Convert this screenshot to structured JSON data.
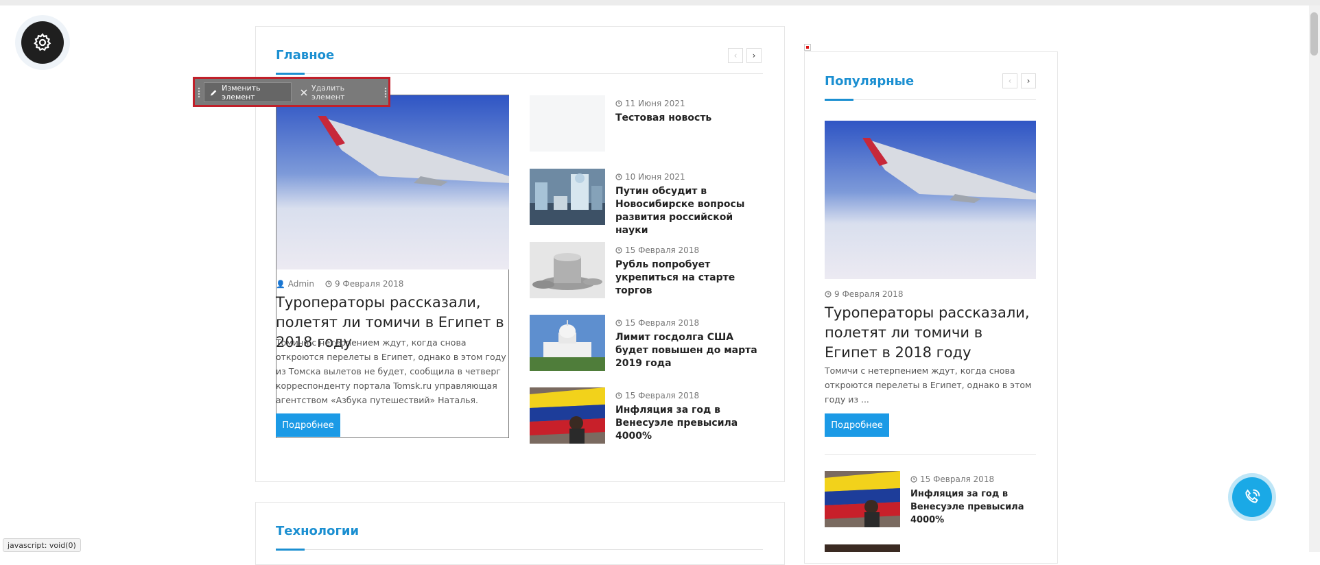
{
  "status_bar": {
    "text": "javascript: void(0)"
  },
  "edit_toolbar": {
    "edit_label": "Изменить элемент",
    "delete_label": "Удалить элемент"
  },
  "main_section": {
    "title": "Главное",
    "featured": {
      "author": "Admin",
      "date": "9 Февраля 2018",
      "title": "Туроператоры рассказали, полетят ли томичи в Египет в 2018 году",
      "excerpt": "Томичи с нетерпением ждут, когда снова откроются перелеты в Египет, однако в этом году из Томска вылетов не будет, сообщила в четверг корреспонденту портала Tomsk.ru управляющая агентством «Азбука путешествий» Наталья.",
      "button": "Подробнее"
    },
    "items": [
      {
        "date": "11 Июня 2021",
        "title": "Тестовая новость"
      },
      {
        "date": "10 Июня 2021",
        "title": "Путин обсудит в Новосибирске вопросы развития российской науки"
      },
      {
        "date": "15 Февраля 2018",
        "title": "Рубль попробует укрепиться на старте торгов"
      },
      {
        "date": "15 Февраля 2018",
        "title": "Лимит госдолга США будет повышен до марта 2019 года"
      },
      {
        "date": "15 Февраля 2018",
        "title": "Инфляция за год в Венесуэле превысила 4000%"
      }
    ]
  },
  "tech_section": {
    "title": "Технологии"
  },
  "popular_section": {
    "title": "Популярные",
    "featured": {
      "date": "9 Февраля 2018",
      "title": "Туроператоры рассказали, полетят ли томичи в Египет в 2018 году",
      "excerpt": "Томичи с нетерпением ждут, когда снова откроются перелеты в Египет, однако в этом году из ...",
      "button": "Подробнее"
    },
    "items": [
      {
        "date": "15 Февраля 2018",
        "title": "Инфляция за год в Венесуэле превысила 4000%"
      }
    ]
  },
  "nav": {
    "prev": "‹",
    "next": "›"
  }
}
